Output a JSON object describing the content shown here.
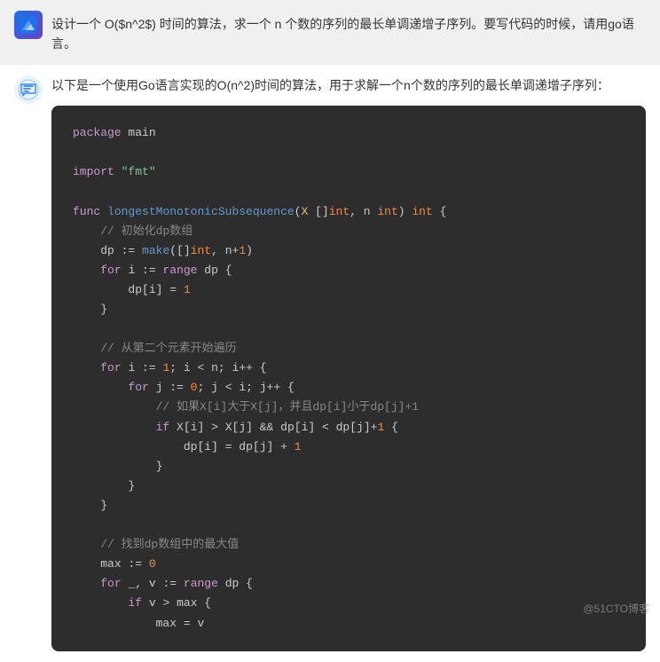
{
  "user": {
    "avatar_label": "user-avatar",
    "message": "设计一个 O($n^2$) 时间的算法，求一个 n 个数的序列的最长单调递增子序列。要写代码的时候，请用go语言。"
  },
  "assistant": {
    "avatar_label": "assistant-avatar",
    "intro": "以下是一个使用Go语言实现的O(n^2)时间的算法，用于求解一个n个数的序列的最长单调递增子序列：",
    "code": {
      "package_line": "package main",
      "import_line": "import \"fmt\"",
      "func_sig": "func longestMonotonicSubsequence(X []int, n int) int {",
      "comment1": "// 初始化dp数组",
      "dp_init": "dp := make([]int, n+1)",
      "for_range": "for i := range dp {",
      "dp_one": "    dp[i] = 1",
      "close1": "}",
      "comment2": "// 从第二个元素开始遍历",
      "for_i": "for i := 1; i < n; i++ {",
      "for_j": "    for j := 0; j < i; j++ {",
      "comment3": "        // 如果X[i]大于X[j]，并且dp[i]小于dp[j]+1",
      "if_cond": "        if X[i] > X[j] && dp[i] < dp[j]+1 {",
      "dp_update": "            dp[i] = dp[j] + 1",
      "close_if": "        }",
      "close_j": "    }",
      "close_i": "}",
      "comment4": "// 找到dp数组中的最大值",
      "max_init": "max := 0",
      "for_range2": "for _, v := range dp {",
      "if_v": "    if v > max {",
      "max_update": "        max = v"
    }
  },
  "watermark": "@51CTO博客"
}
